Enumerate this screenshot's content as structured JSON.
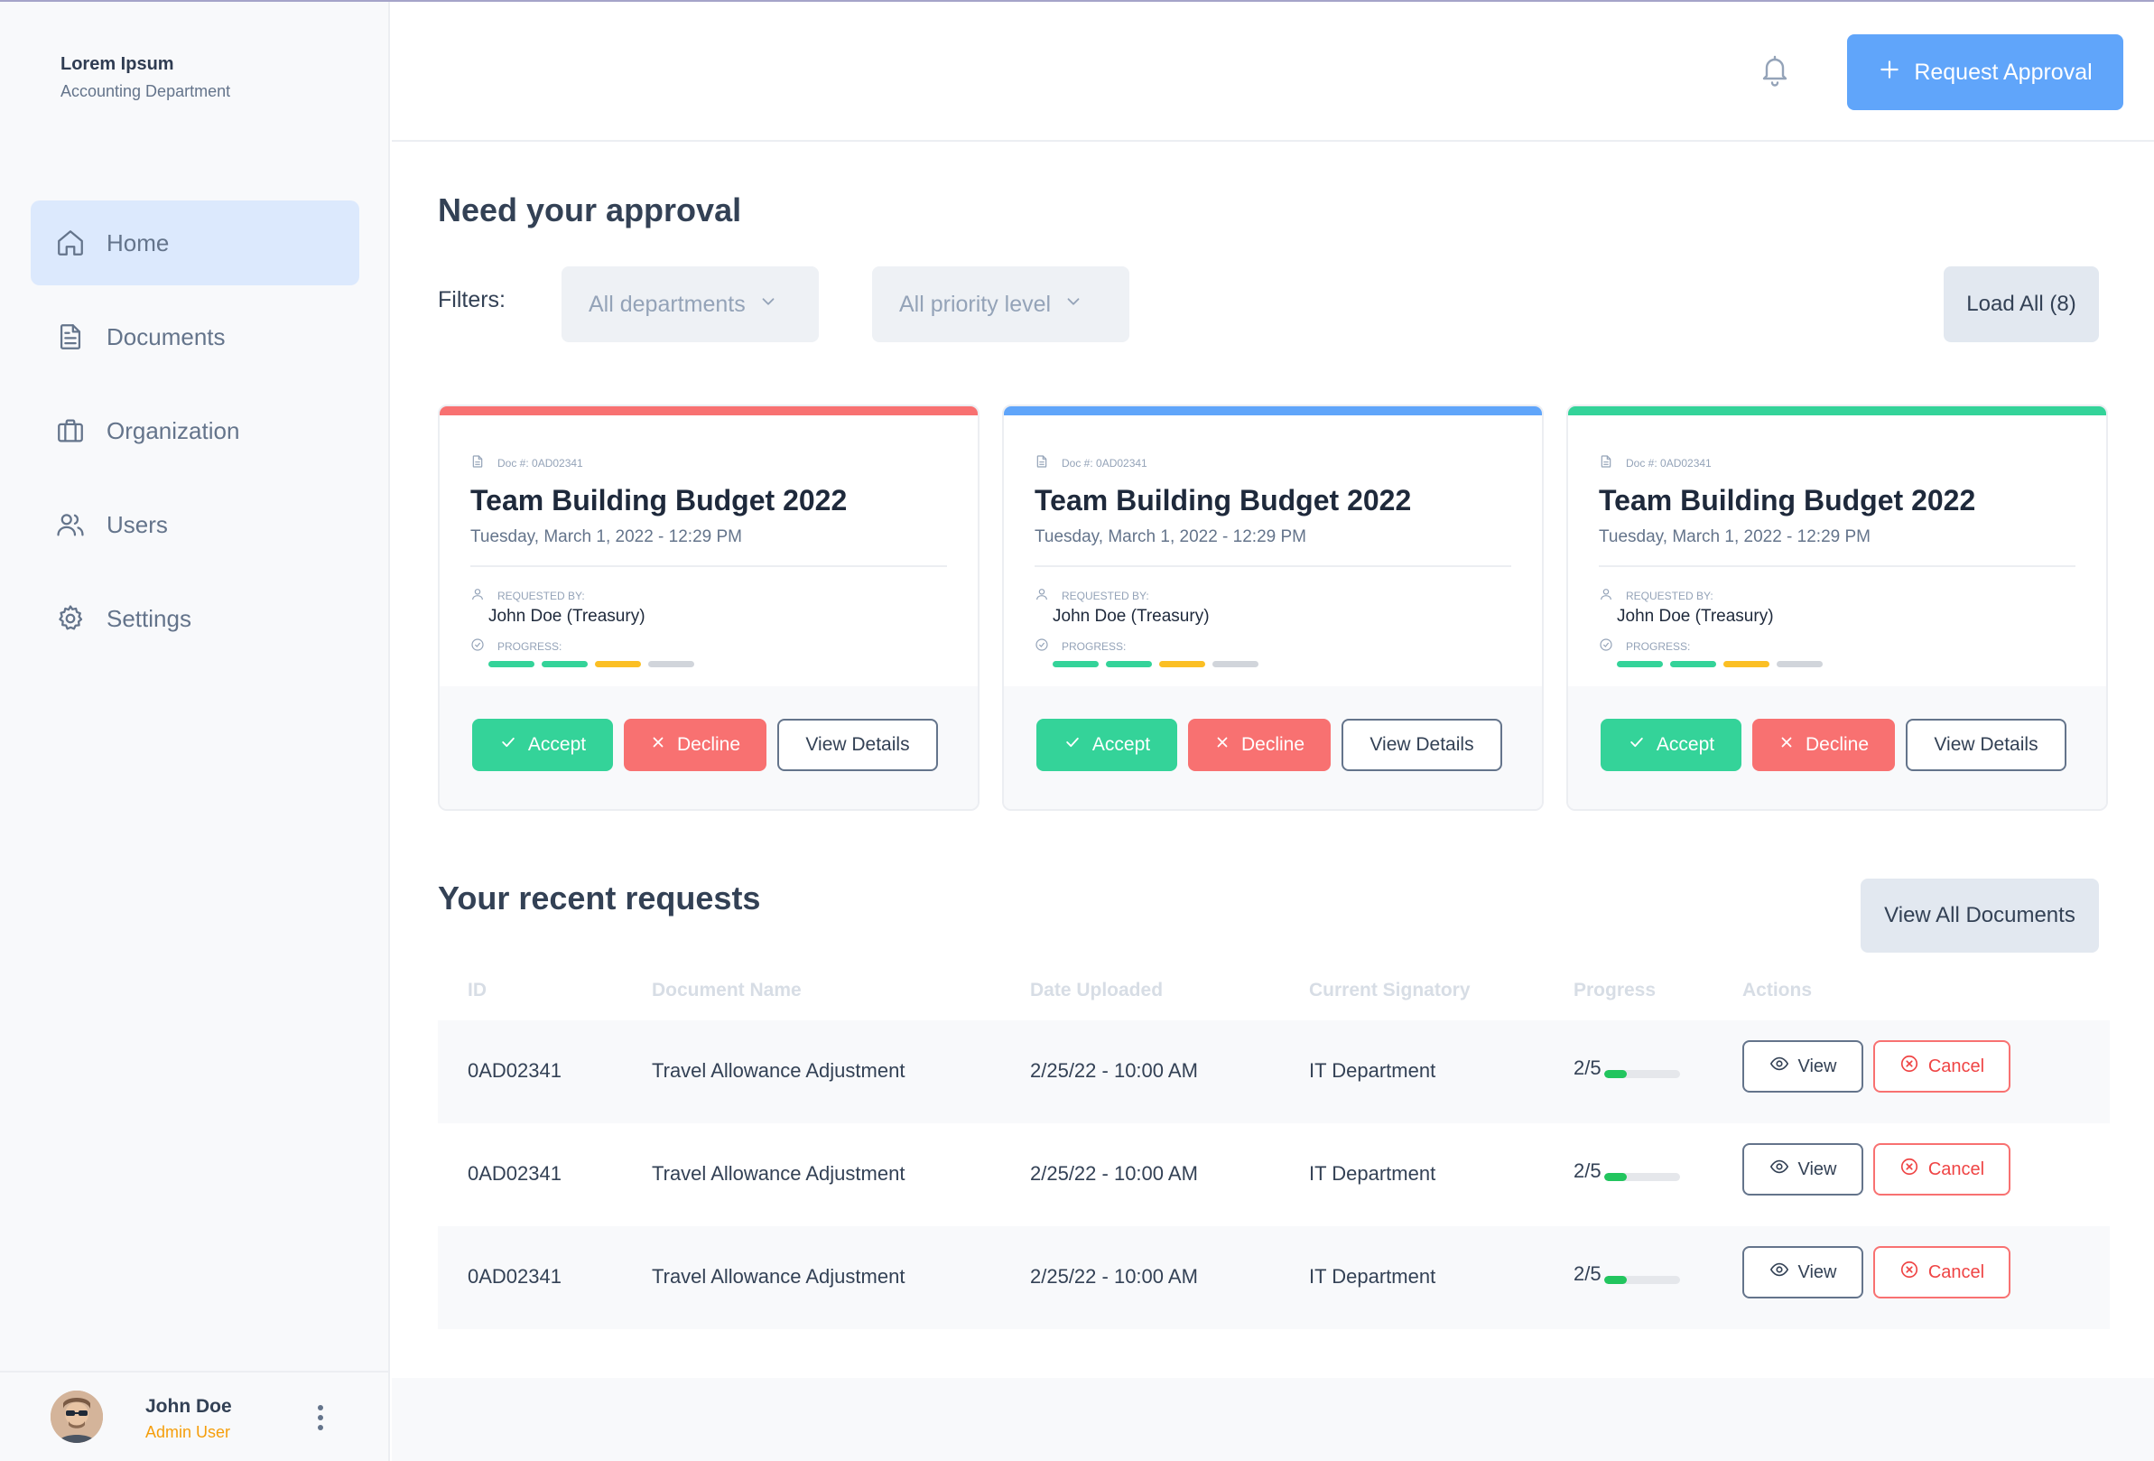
{
  "org": {
    "name": "Lorem Ipsum",
    "department": "Accounting Department"
  },
  "sidebar": {
    "items": [
      {
        "label": "Home",
        "icon": "home-icon",
        "active": true
      },
      {
        "label": "Documents",
        "icon": "document-icon",
        "active": false
      },
      {
        "label": "Organization",
        "icon": "briefcase-icon",
        "active": false
      },
      {
        "label": "Users",
        "icon": "users-icon",
        "active": false
      },
      {
        "label": "Settings",
        "icon": "gear-icon",
        "active": false
      }
    ]
  },
  "user": {
    "name": "John Doe",
    "role": "Admin User"
  },
  "header": {
    "request_button": "Request Approval"
  },
  "approval": {
    "title": "Need your approval",
    "filters_label": "Filters:",
    "filter_departments": "All departments",
    "filter_priority": "All priority level",
    "load_all": "Load All (8)",
    "cards": [
      {
        "accent": "#f87171",
        "doc_number": "Doc #: 0AD02341",
        "title": "Team Building Budget 2022",
        "date": "Tuesday, March 1, 2022 - 12:29 PM",
        "requested_by_label": "REQUESTED BY:",
        "requested_by": "John Doe (Treasury)",
        "progress_label": "PROGRESS:",
        "accept": "Accept",
        "decline": "Decline",
        "view": "View Details"
      },
      {
        "accent": "#60a5fa",
        "doc_number": "Doc #: 0AD02341",
        "title": "Team Building Budget 2022",
        "date": "Tuesday, March 1, 2022 - 12:29 PM",
        "requested_by_label": "REQUESTED BY:",
        "requested_by": "John Doe (Treasury)",
        "progress_label": "PROGRESS:",
        "accept": "Accept",
        "decline": "Decline",
        "view": "View Details"
      },
      {
        "accent": "#34d399",
        "doc_number": "Doc #: 0AD02341",
        "title": "Team Building Budget 2022",
        "date": "Tuesday, March 1, 2022 - 12:29 PM",
        "requested_by_label": "REQUESTED BY:",
        "requested_by": "John Doe (Treasury)",
        "progress_label": "PROGRESS:",
        "accept": "Accept",
        "decline": "Decline",
        "view": "View Details"
      }
    ],
    "progress_segment_colors": [
      "#34d399",
      "#34d399",
      "#fbbf24",
      "#d1d5db"
    ]
  },
  "recent": {
    "title": "Your recent requests",
    "view_all": "View All Documents",
    "columns": [
      "ID",
      "Document Name",
      "Date Uploaded",
      "Current Signatory",
      "Progress",
      "Actions"
    ],
    "rows": [
      {
        "id": "0AD02341",
        "name": "Travel Allowance Adjustment",
        "date": "2/25/22 - 10:00 AM",
        "signatory": "IT Department",
        "progress": "2/5",
        "progress_fraction": 0.3,
        "view": "View",
        "cancel": "Cancel"
      },
      {
        "id": "0AD02341",
        "name": "Travel Allowance Adjustment",
        "date": "2/25/22 - 10:00 AM",
        "signatory": "IT Department",
        "progress": "2/5",
        "progress_fraction": 0.3,
        "view": "View",
        "cancel": "Cancel"
      },
      {
        "id": "0AD02341",
        "name": "Travel Allowance Adjustment",
        "date": "2/25/22 - 10:00 AM",
        "signatory": "IT Department",
        "progress": "2/5",
        "progress_fraction": 0.3,
        "view": "View",
        "cancel": "Cancel"
      }
    ]
  },
  "colors": {
    "primary": "#60a5fa",
    "accept": "#34d399",
    "decline": "#f87171",
    "role": "#f59e0b"
  }
}
